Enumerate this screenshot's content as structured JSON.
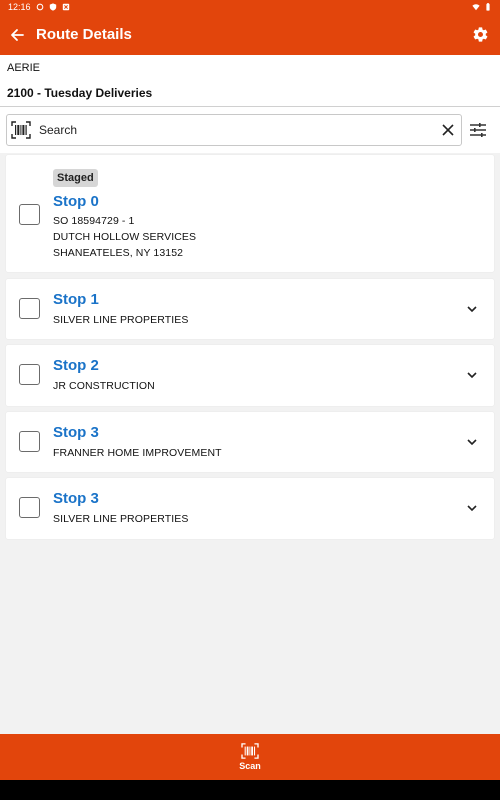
{
  "status_bar": {
    "time": "12:16",
    "icons": [
      "sync-icon",
      "shield-icon",
      "notification-icon",
      "wifi-icon",
      "battery-icon"
    ]
  },
  "app_bar": {
    "title": "Route Details",
    "back_icon": "arrow-left-icon",
    "settings_icon": "gear-icon"
  },
  "header": {
    "company": "AERIE",
    "route": "2100 - Tuesday Deliveries"
  },
  "search": {
    "placeholder": "Search",
    "value": ""
  },
  "stops": [
    {
      "badge": "Staged",
      "title": "Stop 0",
      "lines": [
        "SO 18594729 - 1",
        "DUTCH HOLLOW SERVICES",
        "SHANEATELES, NY 13152"
      ],
      "expanded": true
    },
    {
      "title": "Stop 1",
      "lines": [
        "SILVER LINE PROPERTIES"
      ],
      "expanded": false
    },
    {
      "title": "Stop 2",
      "lines": [
        "JR CONSTRUCTION"
      ],
      "expanded": false
    },
    {
      "title": "Stop 3",
      "lines": [
        "FRANNER HOME IMPROVEMENT"
      ],
      "expanded": false
    },
    {
      "title": "Stop 3",
      "lines": [
        "SILVER LINE PROPERTIES"
      ],
      "expanded": false
    }
  ],
  "bottom_bar": {
    "scan_label": "Scan"
  },
  "colors": {
    "brand": "#e2450c",
    "link": "#1a73c8",
    "background": "#f2f2f2"
  }
}
